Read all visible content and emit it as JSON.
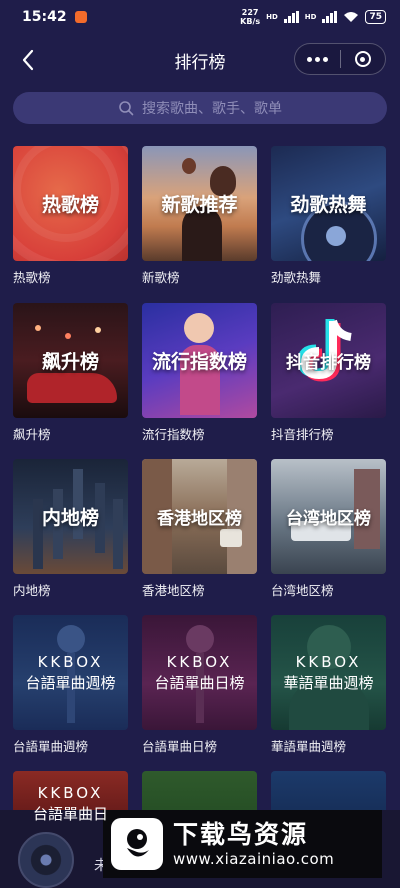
{
  "status": {
    "time": "15:42",
    "speed_top": "227",
    "speed_bottom": "KB/s",
    "hd1": "HD",
    "hd2": "HD",
    "battery": "75"
  },
  "nav": {
    "title": "排行榜"
  },
  "search": {
    "placeholder": "搜索歌曲、歌手、歌单"
  },
  "cards": [
    {
      "cover_text": "热歌榜",
      "label": "热歌榜",
      "bg": "#e0543f"
    },
    {
      "cover_text": "新歌推荐",
      "label": "新歌榜",
      "bg": "#c98a60"
    },
    {
      "cover_text": "劲歌热舞",
      "label": "劲歌热舞",
      "bg": "#2b3a6a"
    },
    {
      "cover_text": "飙升榜",
      "label": "飙升榜",
      "bg": "#3b1a22"
    },
    {
      "cover_text": "流行指数榜",
      "label": "流行指数榜",
      "bg": "#3c2a8f"
    },
    {
      "cover_text": "抖音排行榜",
      "label": "抖音排行榜",
      "bg": "#3a2460"
    },
    {
      "cover_text": "内地榜",
      "label": "内地榜",
      "bg": "#263247"
    },
    {
      "cover_text": "香港地区榜",
      "label": "香港地区榜",
      "bg": "#8d6e58"
    },
    {
      "cover_text": "台湾地区榜",
      "label": "台湾地区榜",
      "bg": "#6d7c88"
    },
    {
      "kk_top": "KKBOX",
      "kk_bottom": "台語單曲週榜",
      "label": "台語單曲週榜",
      "bg": "#1f3565"
    },
    {
      "kk_top": "KKBOX",
      "kk_bottom": "台語單曲日榜",
      "label": "台語單曲日榜",
      "bg": "#4a1d46"
    },
    {
      "kk_top": "KKBOX",
      "kk_bottom": "華語單曲週榜",
      "label": "華語單曲週榜",
      "bg": "#1f4a3e"
    }
  ],
  "partial_cards": [
    {
      "kk_top": "KKBOX",
      "kk_bottom": "台語單曲日",
      "bg": "#7a1e1e"
    },
    {
      "bg": "#2f5a2c"
    },
    {
      "bg": "#1c3a6a"
    }
  ],
  "player": {
    "text": "未"
  },
  "watermark": {
    "cn": "下载鸟资源",
    "url": "www.xiazainiao.com"
  }
}
